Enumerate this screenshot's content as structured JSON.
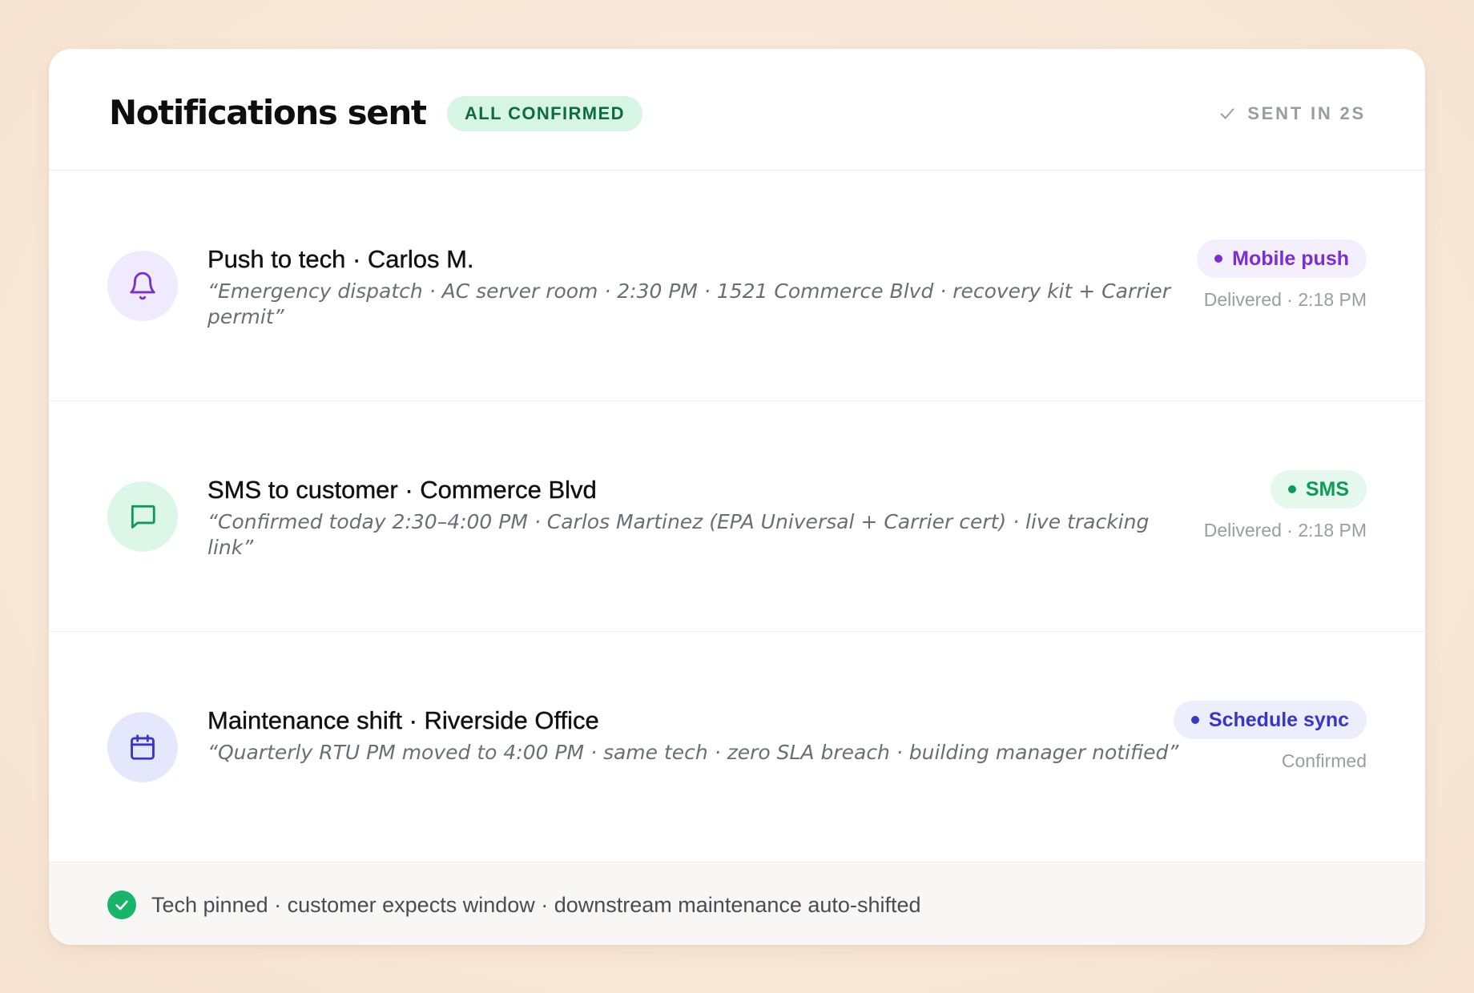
{
  "header": {
    "title": "Notifications sent",
    "badge": "ALL CONFIRMED",
    "status": "SENT IN 2S",
    "status_icon": "check-icon"
  },
  "notifications": [
    {
      "icon": "bell-icon",
      "title": "Push to tech · Carlos M.",
      "message": "“Emergency dispatch · AC server room · 2:30 PM · 1521 Commerce Blvd · recovery kit + Carrier permit”",
      "channel": "Mobile push",
      "status": "Delivered · 2:18 PM",
      "color": "#7a2fd6"
    },
    {
      "icon": "chat-bubble-icon",
      "title": "SMS to customer · Commerce Blvd",
      "message": "“Confirmed today 2:30–4:00 PM · Carlos Martinez (EPA Universal + Carrier cert) · live tracking link”",
      "channel": "SMS",
      "status": "Delivered · 2:18 PM",
      "color": "#0f9a5a"
    },
    {
      "icon": "calendar-icon",
      "title": "Maintenance shift · Riverside Office",
      "message": "“Quarterly RTU PM moved to 4:00 PM · same tech · zero SLA breach · building manager notified”",
      "channel": "Schedule sync",
      "status": "Confirmed",
      "color": "#3a35c9"
    }
  ],
  "footer": {
    "icon": "check-circle-icon",
    "text": "Tech pinned · customer expects window · downstream maintenance auto-shifted",
    "color": "#18b46a"
  }
}
